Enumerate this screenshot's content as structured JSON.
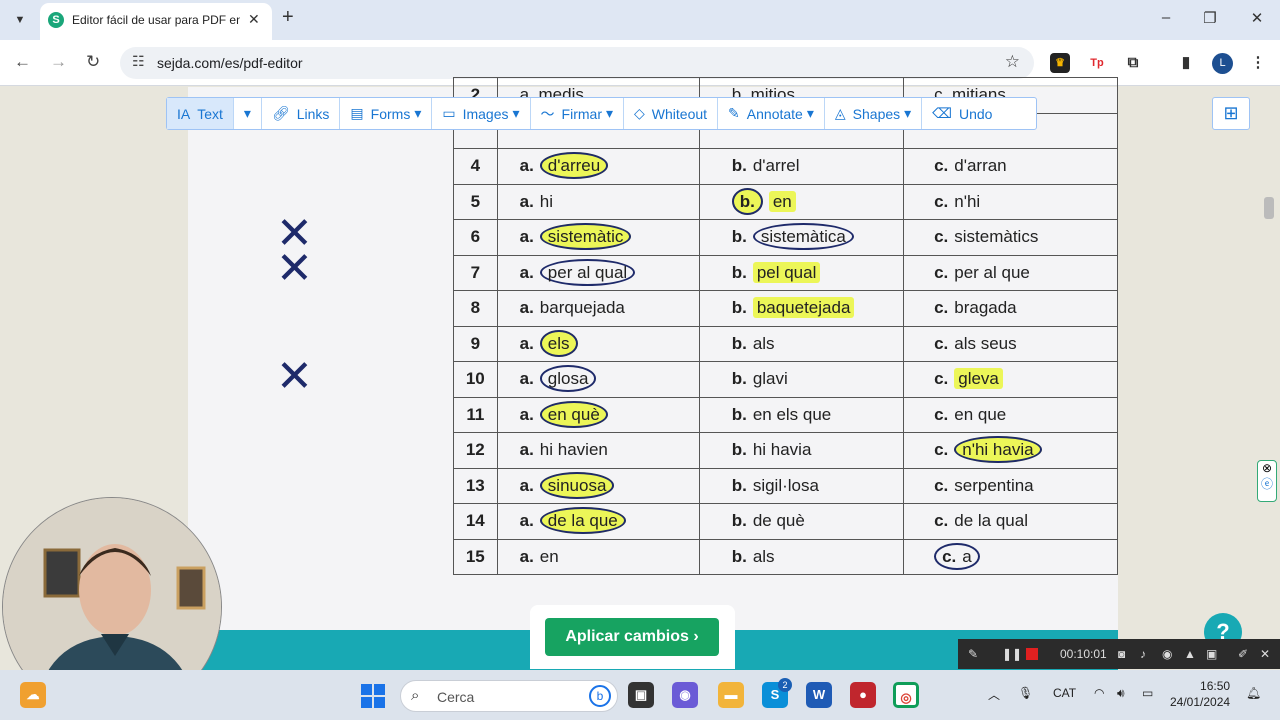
{
  "browser": {
    "tab_title": "Editor fácil de usar para PDF en",
    "url": "sejda.com/es/pdf-editor",
    "profile_initial": "L"
  },
  "toolbar": {
    "text": "Text",
    "links": "Links",
    "forms": "Forms",
    "images": "Images",
    "firmar": "Firmar",
    "whiteout": "Whiteout",
    "annotate": "Annotate",
    "shapes": "Shapes",
    "undo": "Undo"
  },
  "worksheet": {
    "partial_row": {
      "num": "2",
      "a": "a. medis",
      "b": "b. mitjos",
      "c": "c. mitjans"
    },
    "rows": [
      {
        "num": "4",
        "a": "d'arreu",
        "b": "d'arrel",
        "c": "d'arran"
      },
      {
        "num": "5",
        "a": "hi",
        "b": "en",
        "c": "n'hi"
      },
      {
        "num": "6",
        "a": "sistemàtic",
        "b": "sistemàtica",
        "c": "sistemàtics"
      },
      {
        "num": "7",
        "a": "per al qual",
        "b": "pel qual",
        "c": "per al que"
      },
      {
        "num": "8",
        "a": "barquejada",
        "b": "baquetejada",
        "c": "bragada"
      },
      {
        "num": "9",
        "a": "els",
        "b": "als",
        "c": "als seus"
      },
      {
        "num": "10",
        "a": "glosa",
        "b": "glavi",
        "c": "gleva"
      },
      {
        "num": "11",
        "a": "en què",
        "b": "en els que",
        "c": "en que"
      },
      {
        "num": "12",
        "a": "hi havien",
        "b": "hi havia",
        "c": "n'hi havia"
      },
      {
        "num": "13",
        "a": "sinuosa",
        "b": "sigil·losa",
        "c": "serpentina"
      },
      {
        "num": "14",
        "a": "de la que",
        "b": "de què",
        "c": "de la qual"
      },
      {
        "num": "15",
        "a": "en",
        "b": "als",
        "c": "a"
      }
    ],
    "labels": {
      "a": "a.",
      "b": "b.",
      "c": "c."
    }
  },
  "apply_button": "Aplicar cambios ›",
  "recorder": {
    "time": "00:10:01"
  },
  "taskbar": {
    "search_placeholder": "Cerca",
    "language": "CAT",
    "time": "16:50",
    "date": "24/01/2024",
    "skype_badge": "2"
  },
  "colors": {
    "accent": "#1976d2",
    "apply": "#17a361",
    "footer": "#18a9b4",
    "highlight": "#eaf63c"
  }
}
